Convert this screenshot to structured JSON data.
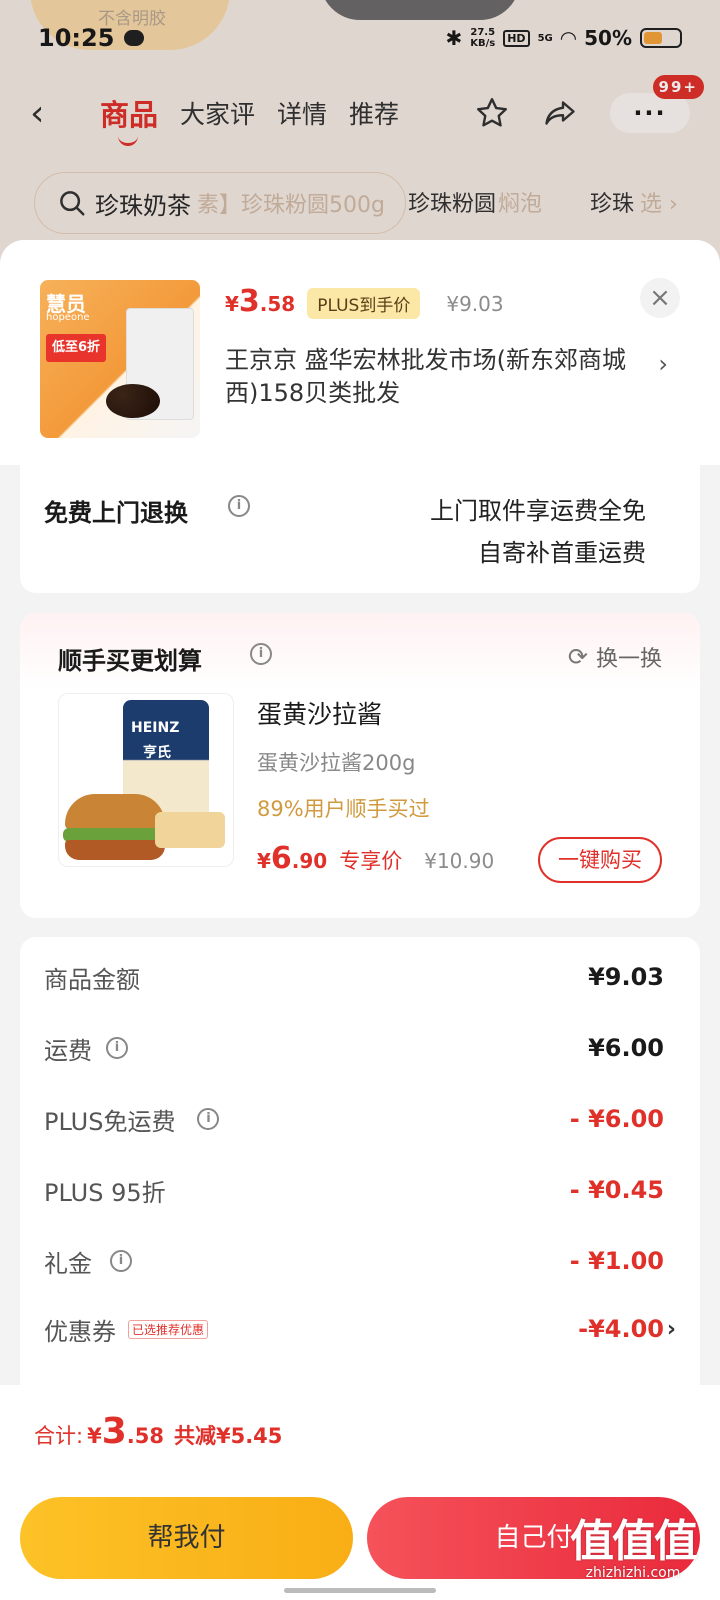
{
  "background": {
    "faint_text": "不含明胶",
    "status": {
      "time": "10:25",
      "net_speed": "27.5",
      "net_unit": "KB/s",
      "hd": "HD",
      "signal": "5G",
      "battery": "50%"
    },
    "nav": {
      "back": "‹",
      "tabs": [
        "商品",
        "大家评",
        "详情",
        "推荐"
      ],
      "more": "···",
      "badge": "99+"
    },
    "search": {
      "query": "珍珠奶茶",
      "behind_text": "素】珍珠粉圆500g",
      "chip1": "珍珠粉圆",
      "chip1_suffix": "焖泡",
      "chip2": "珍珠",
      "chip2_suffix": "选 ›"
    }
  },
  "product": {
    "image_brand": "慧员",
    "image_brand_en": "hopeone",
    "image_badge": "低至6折",
    "price_currency": "¥",
    "price_int": "3",
    "price_dec": ".58",
    "plus_tag": "PLUS到手价",
    "orig_price": "¥9.03",
    "close": "×",
    "seller": "王京京  盛华宏林批发市场(新东郊商城西)158贝类批发",
    "seller_arrow": "›"
  },
  "returns": {
    "title": "免费上门退换",
    "info": "i",
    "line1": "上门取件享运费全免",
    "line2": "自寄补首重运费"
  },
  "addon": {
    "title": "顺手买更划算",
    "swap": "换一换",
    "image_brand": "HEINZ",
    "image_cn": "亨氏",
    "name": "蛋黄沙拉酱",
    "spec": "蛋黄沙拉酱200g",
    "bought": "89%用户顺手买过",
    "price_currency": "¥",
    "price_int": "6",
    "price_dec": ".90",
    "exclusive": "专享价",
    "orig_price": "¥10.90",
    "buy_label": "一键购买"
  },
  "summary": {
    "rows": [
      {
        "label": "商品金额",
        "value": "¥9.03",
        "info": false,
        "red": false
      },
      {
        "label": "运费",
        "value": "¥6.00",
        "info": true,
        "red": false
      },
      {
        "label": "PLUS免运费",
        "value": "- ¥6.00",
        "info": true,
        "red": true
      },
      {
        "label": "PLUS 95折",
        "value": "- ¥0.45",
        "info": false,
        "red": true
      },
      {
        "label": "礼金",
        "value": "- ¥1.00",
        "info": true,
        "red": true
      },
      {
        "label": "优惠券",
        "value": "-¥4.00",
        "info": false,
        "red": true,
        "tag": "已选推荐优惠"
      }
    ]
  },
  "total": {
    "label": "合计:",
    "currency": "¥",
    "int": "3",
    "dec": ".58",
    "saved": "共减¥5.45"
  },
  "buttons": {
    "help_pay": "帮我付",
    "self_pay": "自己付"
  },
  "watermark": {
    "logo": "值值值",
    "url": "zhizhizhi.com"
  },
  "colors": {
    "accent": "#e0302a",
    "gold": "#f9ae15",
    "pay_red": "#ea2a3c"
  }
}
